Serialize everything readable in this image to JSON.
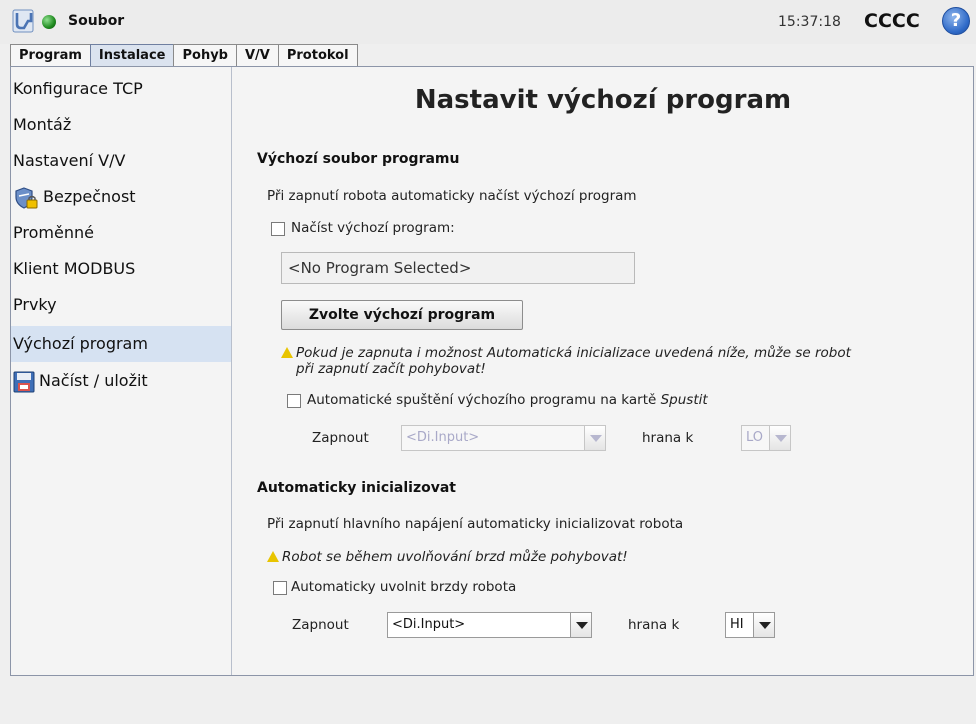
{
  "header": {
    "app_title": "Soubor",
    "clock": "15:37:18",
    "robot_name": "CCCC",
    "help_glyph": "?"
  },
  "tabs": [
    {
      "label": "Program",
      "active": false
    },
    {
      "label": "Instalace",
      "active": true
    },
    {
      "label": "Pohyb",
      "active": false
    },
    {
      "label": "V/V",
      "active": false
    },
    {
      "label": "Protokol",
      "active": false
    }
  ],
  "sidebar": {
    "items": [
      {
        "label": "Konfigurace TCP"
      },
      {
        "label": "Montáž"
      },
      {
        "label": "Nastavení V/V"
      },
      {
        "label": "Bezpečnost",
        "icon": "safety-shield-lock-icon"
      },
      {
        "label": "Proměnné"
      },
      {
        "label": "Klient MODBUS"
      },
      {
        "label": "Prvky"
      },
      {
        "label": "Výchozí program",
        "selected": true
      },
      {
        "label": "Načíst / uložit",
        "icon": "floppy-disk-icon"
      }
    ]
  },
  "main": {
    "title": "Nastavit výchozí program",
    "default_file": {
      "heading": "Výchozí soubor programu",
      "description": "Při zapnutí robota automaticky načíst výchozí program",
      "load_checkbox_label": "Načíst výchozí program:",
      "load_checkbox_checked": false,
      "program_field_value": "<No Program Selected>",
      "choose_button_label": "Zvolte výchozí program",
      "warning_line1": "Pokud je zapnuta i možnost Automatická inicializace uvedená níže, může se robot",
      "warning_line2": "při zapnutí začít pohybovat!",
      "autostart_checkbox_label_prefix": "Automatické spuštění výchozího programu na kartě ",
      "autostart_checkbox_label_em": "Spustit",
      "autostart_checkbox_checked": false,
      "enable_label": "Zapnout",
      "input_combo_value": "<Di.Input>",
      "edge_label": "hrana k",
      "edge_combo_value": "LO"
    },
    "auto_init": {
      "heading": "Automaticky inicializovat",
      "description": "Při zapnutí hlavního napájení automaticky inicializovat robota",
      "warning": "Robot se během uvolňování brzd může pohybovat!",
      "release_checkbox_label": "Automaticky uvolnit brzdy robota",
      "release_checkbox_checked": false,
      "enable_label": "Zapnout",
      "input_combo_value": "<Di.Input>",
      "edge_label": "hrana k",
      "edge_combo_value": "HI"
    }
  },
  "colors": {
    "selected_bg": "#d6e2f2",
    "warning_yellow": "#e8c400",
    "status_green": "#1f8a1f",
    "help_blue": "#2f6ac8"
  }
}
